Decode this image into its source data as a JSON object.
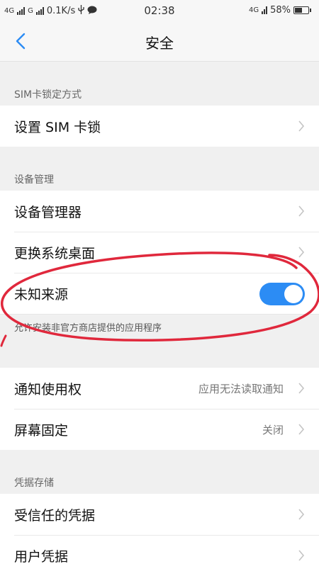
{
  "status_bar": {
    "signal1_label": "4G",
    "signal2_label": "G",
    "speed": "0.1K/s",
    "time": "02:38",
    "network": "4G",
    "battery_percent": "58%",
    "battery_level": 0.58
  },
  "header": {
    "title": "安全"
  },
  "sections": {
    "sim": {
      "header": "SIM卡锁定方式",
      "set_sim_lock": "设置 SIM 卡锁"
    },
    "device": {
      "header": "设备管理",
      "device_admin": "设备管理器",
      "change_launcher": "更换系统桌面",
      "unknown_sources": "未知来源",
      "unknown_sources_enabled": true,
      "unknown_sources_desc": "允许安装非官方商店提供的应用程序"
    },
    "misc": {
      "notification_access": "通知使用权",
      "notification_access_value": "应用无法读取通知",
      "screen_pinning": "屏幕固定",
      "screen_pinning_value": "关闭"
    },
    "credentials": {
      "header": "凭据存储",
      "trusted_credentials": "受信任的凭据",
      "user_credentials": "用户凭据"
    }
  },
  "colors": {
    "accent": "#2c8cf4",
    "annotation": "#e0283c"
  }
}
